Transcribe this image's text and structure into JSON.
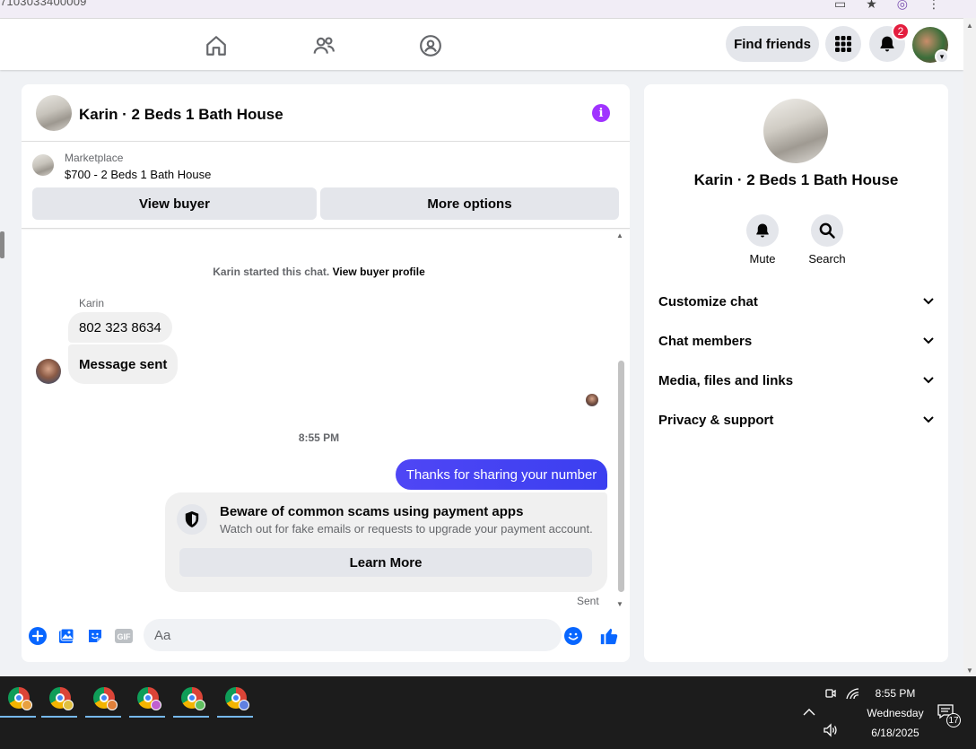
{
  "browser": {
    "url_fragment": "7103033400009"
  },
  "navbar": {
    "find_friends_label": "Find friends",
    "notification_count": "2"
  },
  "chat": {
    "title": "Karin · 2 Beds 1 Bath House",
    "listing": {
      "label": "Marketplace",
      "price_title": "$700 - 2 Beds 1 Bath House"
    },
    "view_buyer_label": "View buyer",
    "more_options_label": "More options",
    "system_text": "Karin started this chat.",
    "system_link": "View buyer profile",
    "sender_name": "Karin",
    "incoming": [
      "802 323 8634",
      "Message sent"
    ],
    "timestamp": "8:55 PM",
    "outgoing": "Thanks for sharing your number",
    "scam_card": {
      "title": "Beware of common scams using payment apps",
      "subtitle": "Watch out for fake emails or requests to upgrade your payment account.",
      "button_label": "Learn More"
    },
    "status": "Sent",
    "composer_placeholder": "Aa"
  },
  "info_panel": {
    "title": "Karin · 2 Beds 1 Bath House",
    "actions": [
      "Mute",
      "Search"
    ],
    "sections": [
      "Customize chat",
      "Chat members",
      "Media, files and links",
      "Privacy & support"
    ]
  },
  "taskbar": {
    "time": "8:55 PM",
    "day": "Wednesday",
    "date": "6/18/2025",
    "notification_count": "17",
    "app_badge_colors": [
      "#e8a040",
      "#e0c040",
      "#e0803a",
      "#c060d0",
      "#60c060",
      "#6080e0"
    ]
  },
  "colors": {
    "accent_blue": "#0866ff",
    "messenger_purple": "#a033ff",
    "outgoing_bubble": "#4f46f5",
    "badge_red": "#e41e3f"
  }
}
